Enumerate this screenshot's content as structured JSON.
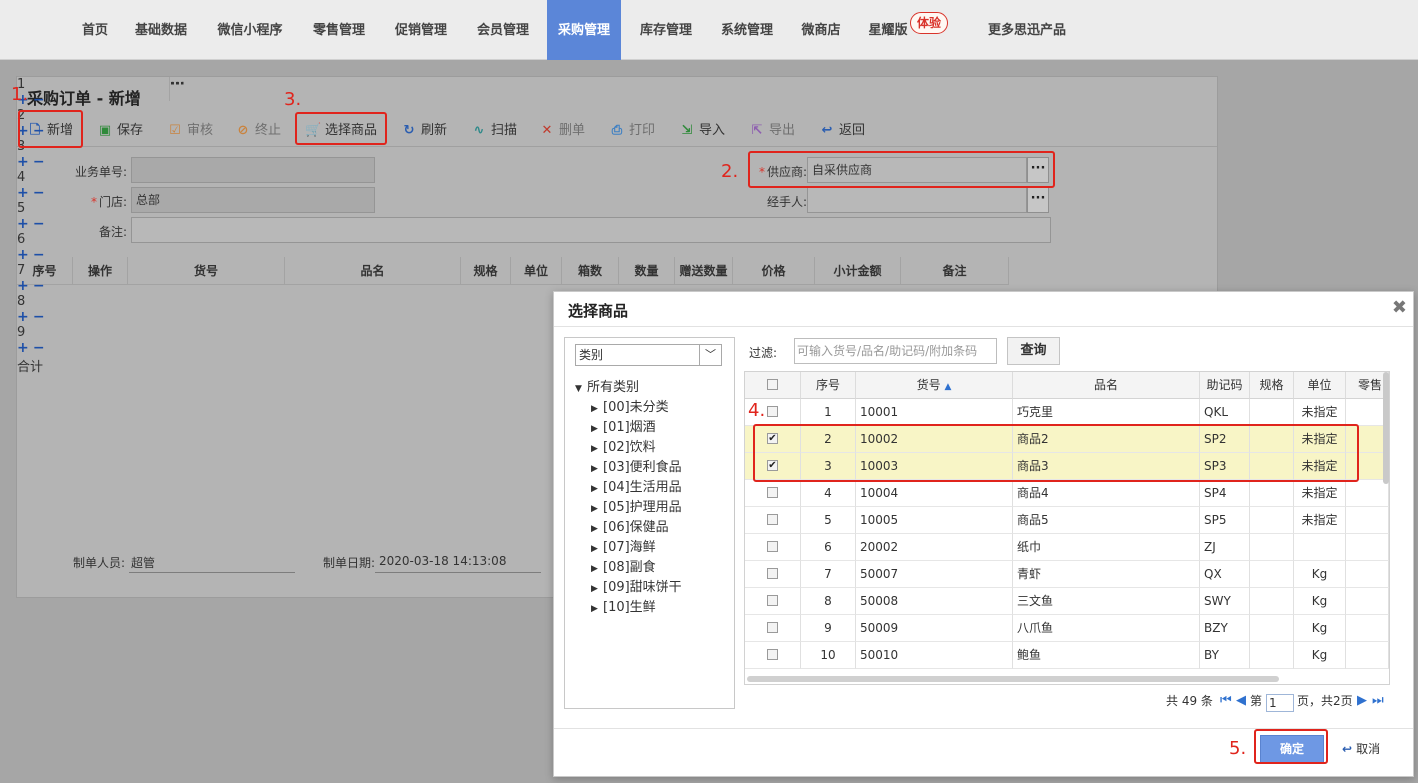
{
  "nav": {
    "items": [
      "首页",
      "基础数据",
      "微信小程序",
      "零售管理",
      "促销管理",
      "会员管理",
      "采购管理",
      "库存管理",
      "系统管理",
      "微商店",
      "星耀版",
      "更多思迅产品"
    ],
    "active": "采购管理",
    "badge": "体验"
  },
  "form": {
    "title": "采购订单 - 新增",
    "toolbar": {
      "new": "新增",
      "save": "保存",
      "audit": "审核",
      "stop": "终止",
      "select_goods": "选择商品",
      "refresh": "刷新",
      "scan": "扫描",
      "delete": "删单",
      "print": "打印",
      "import": "导入",
      "export": "导出",
      "back": "返回"
    },
    "fields": {
      "order_no_label": "业务单号:",
      "order_no": "",
      "store_label": "门店:",
      "store": "总部",
      "remark_label": "备注:",
      "remark": "",
      "supplier_label": "供应商:",
      "supplier": "自采供应商",
      "handler_label": "经手人:",
      "handler": ""
    },
    "grid": {
      "headers": [
        "序号",
        "操作",
        "货号",
        "品名",
        "规格",
        "单位",
        "箱数",
        "数量",
        "赠送数量",
        "价格",
        "小计金额",
        "备注"
      ],
      "rows": [
        "1",
        "2",
        "3",
        "4",
        "5",
        "6",
        "7",
        "8",
        "9"
      ],
      "total_label": "合计",
      "plus": "+",
      "minus": "−"
    },
    "footer": {
      "creator_label": "制单人员:",
      "creator": "超管",
      "date_label": "制单日期:",
      "date": "2020-03-18 14:13:08"
    }
  },
  "annotations": [
    "1.",
    "2.",
    "3.",
    "4.",
    "5."
  ],
  "dialog": {
    "title": "选择商品",
    "category_select": "类别",
    "tree_root": "所有类别",
    "categories": [
      "[00]未分类",
      "[01]烟酒",
      "[02]饮料",
      "[03]便利食品",
      "[04]生活用品",
      "[05]护理用品",
      "[06]保健品",
      "[07]海鲜",
      "[08]副食",
      "[09]甜味饼干",
      "[10]生鲜"
    ],
    "filter_label": "过滤:",
    "filter_placeholder": "可输入货号/品名/助记码/附加条码",
    "query_button": "查询",
    "table_headers": [
      "序号",
      "货号",
      "品名",
      "助记码",
      "规格",
      "单位",
      "零售"
    ],
    "rows": [
      {
        "no": "1",
        "code": "10001",
        "name": "巧克里",
        "mnemonic": "QKL",
        "spec": "",
        "unit": "未指定",
        "checked": false
      },
      {
        "no": "2",
        "code": "10002",
        "name": "商品2",
        "mnemonic": "SP2",
        "spec": "",
        "unit": "未指定",
        "checked": true
      },
      {
        "no": "3",
        "code": "10003",
        "name": "商品3",
        "mnemonic": "SP3",
        "spec": "",
        "unit": "未指定",
        "checked": true
      },
      {
        "no": "4",
        "code": "10004",
        "name": "商品4",
        "mnemonic": "SP4",
        "spec": "",
        "unit": "未指定",
        "checked": false
      },
      {
        "no": "5",
        "code": "10005",
        "name": "商品5",
        "mnemonic": "SP5",
        "spec": "",
        "unit": "未指定",
        "checked": false
      },
      {
        "no": "6",
        "code": "20002",
        "name": "纸巾",
        "mnemonic": "ZJ",
        "spec": "",
        "unit": "",
        "checked": false
      },
      {
        "no": "7",
        "code": "50007",
        "name": "青虾",
        "mnemonic": "QX",
        "spec": "",
        "unit": "Kg",
        "checked": false
      },
      {
        "no": "8",
        "code": "50008",
        "name": "三文鱼",
        "mnemonic": "SWY",
        "spec": "",
        "unit": "Kg",
        "checked": false
      },
      {
        "no": "9",
        "code": "50009",
        "name": "八爪鱼",
        "mnemonic": "BZY",
        "spec": "",
        "unit": "Kg",
        "checked": false
      },
      {
        "no": "10",
        "code": "50010",
        "name": "鲍鱼",
        "mnemonic": "BY",
        "spec": "",
        "unit": "Kg",
        "checked": false
      }
    ],
    "pager": {
      "total": "共 49 条",
      "page_prefix": "第",
      "page": "1",
      "page_suffix": "页，共2页"
    },
    "ok_button": "确定",
    "cancel_button": "取消"
  },
  "colors": {
    "accent": "#5b86d8",
    "annotation": "#e0241c",
    "selected_row": "#f8f5c6",
    "ok_button": "#6e98e4"
  }
}
